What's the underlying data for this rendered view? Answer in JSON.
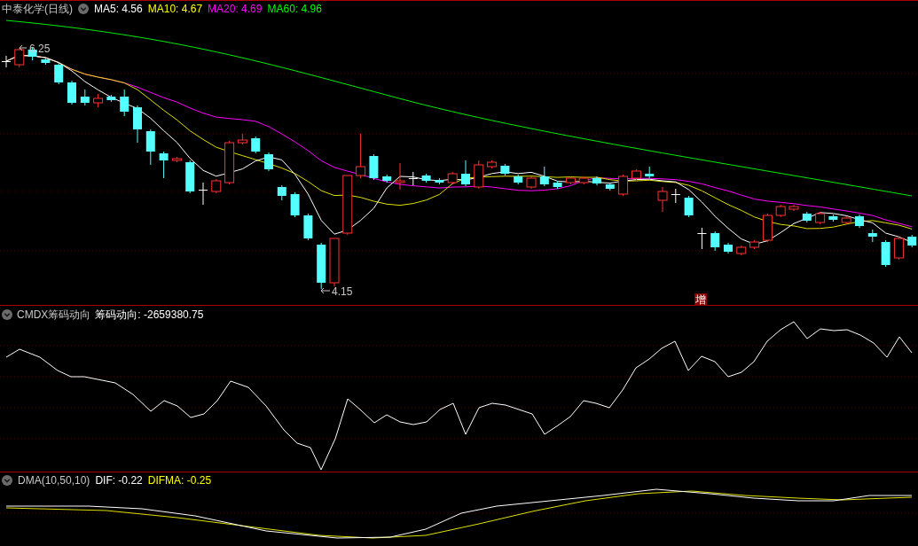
{
  "main_panel": {
    "title": "中泰化学(日线)",
    "indicators": [
      {
        "label": "MA5: 4.56",
        "color": "#ffffff"
      },
      {
        "label": "MA10: 4.67",
        "color": "#ffff00"
      },
      {
        "label": "MA20: 4.69",
        "color": "#ff00ff"
      },
      {
        "label": "MA60: 4.96",
        "color": "#00ff00"
      }
    ],
    "high_label": "6.25",
    "low_label": "4.15",
    "badge": "增"
  },
  "cmdx_panel": {
    "name": "CMDX筹码动向",
    "reading": "筹码动向: -2659380.75"
  },
  "dma_panel": {
    "name": "DMA(10,50,10)",
    "indicators": [
      {
        "label": "DIF: -0.22",
        "color": "#ffffff"
      },
      {
        "label": "DIFMA: -0.25",
        "color": "#ffff00"
      }
    ]
  }
}
